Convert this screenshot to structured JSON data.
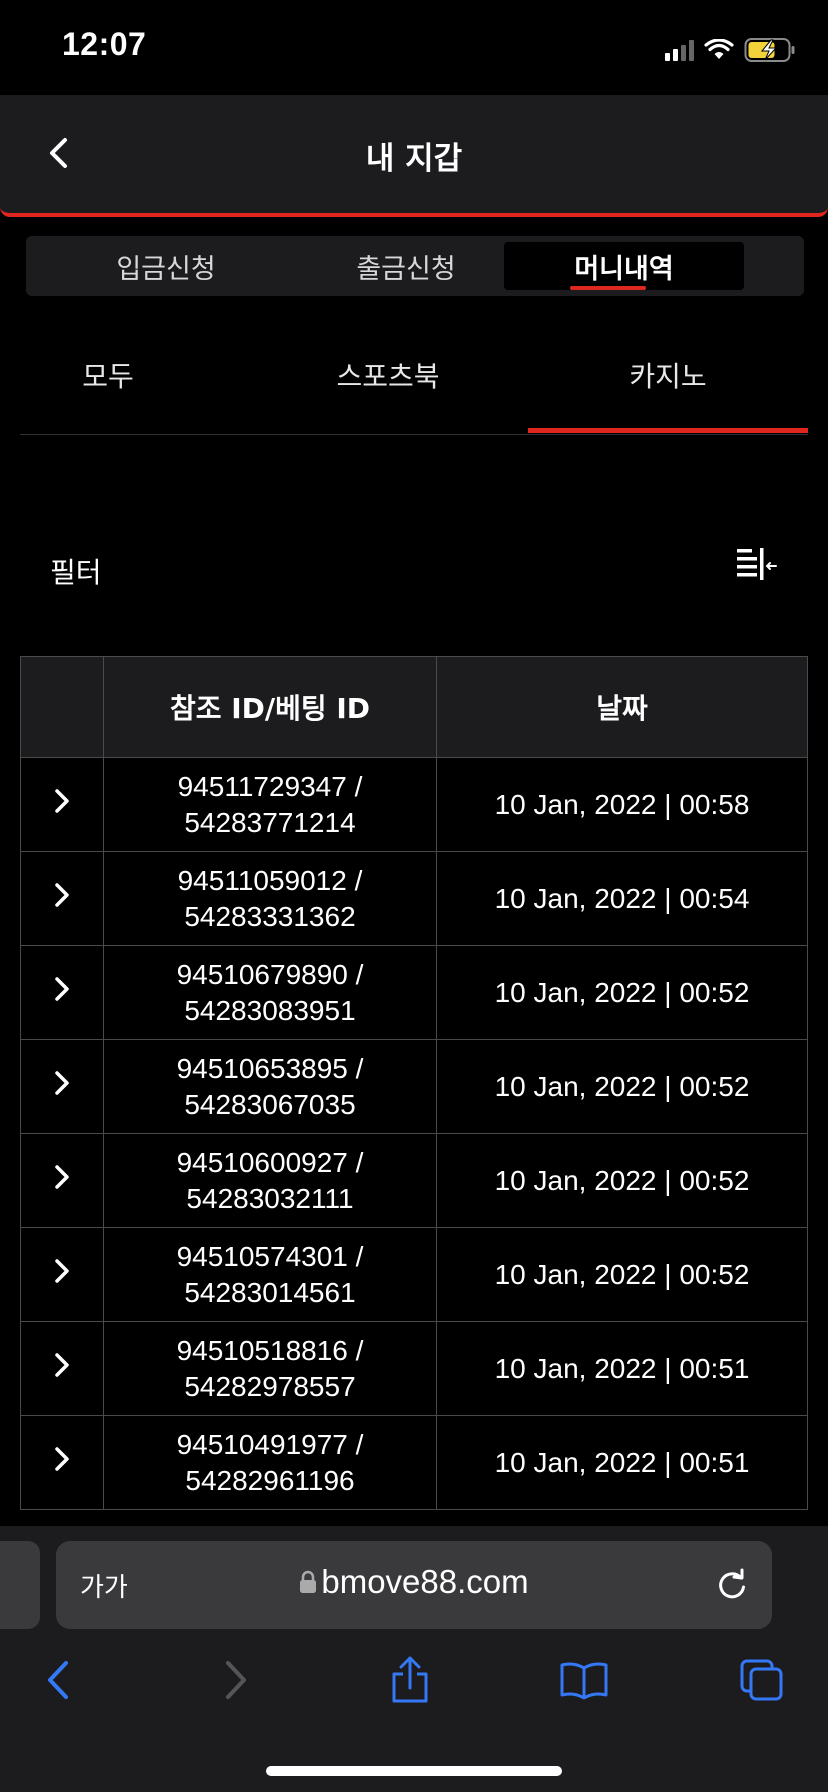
{
  "status": {
    "time": "12:07"
  },
  "header": {
    "title": "내 지갑"
  },
  "segment": {
    "items": [
      "입금신청",
      "출금신청",
      "머니내역"
    ]
  },
  "tabs": [
    "모두",
    "스포츠북",
    "카지노"
  ],
  "filter": {
    "label": "필터"
  },
  "table": {
    "headers": [
      "",
      "참조 ID/베팅 ID",
      "날짜"
    ],
    "rows": [
      {
        "ref1": "94511729347 /",
        "ref2": "54283771214",
        "date": "10 Jan, 2022 | 00:58"
      },
      {
        "ref1": "94511059012 /",
        "ref2": "54283331362",
        "date": "10 Jan, 2022 | 00:54"
      },
      {
        "ref1": "94510679890 /",
        "ref2": "54283083951",
        "date": "10 Jan, 2022 | 00:52"
      },
      {
        "ref1": "94510653895 /",
        "ref2": "54283067035",
        "date": "10 Jan, 2022 | 00:52"
      },
      {
        "ref1": "94510600927 /",
        "ref2": "54283032111",
        "date": "10 Jan, 2022 | 00:52"
      },
      {
        "ref1": "94510574301 /",
        "ref2": "54283014561",
        "date": "10 Jan, 2022 | 00:52"
      },
      {
        "ref1": "94510518816 /",
        "ref2": "54282978557",
        "date": "10 Jan, 2022 | 00:51"
      },
      {
        "ref1": "94510491977 /",
        "ref2": "54282961196",
        "date": "10 Jan, 2022 | 00:51"
      }
    ]
  },
  "browser": {
    "text_size_label": "가가",
    "url": "bmove88.com"
  },
  "colors": {
    "accent": "#e0271f",
    "toolbar_icon": "#3478f6",
    "background": "#000000",
    "surface": "#1c1c1e"
  }
}
